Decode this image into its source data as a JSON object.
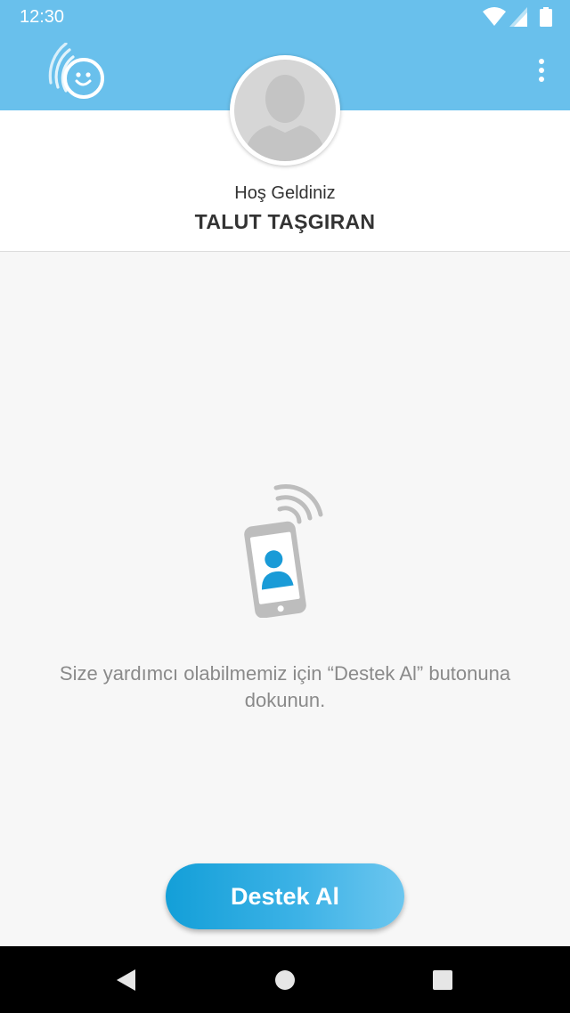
{
  "status_bar": {
    "time": "12:30",
    "icons": [
      "wifi-icon",
      "signal-icon",
      "battery-icon"
    ]
  },
  "header": {
    "logo_icon": "smile-signal-logo",
    "menu_icon": "more-vert-icon"
  },
  "profile": {
    "avatar_icon": "default-user-avatar",
    "welcome": "Hoş Geldiniz",
    "name": "TALUT TAŞGIRAN"
  },
  "main": {
    "illustration_icon": "phone-user-signal-icon",
    "instruction": "Size yardımcı olabilmemiz için “Destek Al” butonuna dokunun."
  },
  "actions": {
    "support_button": "Destek Al"
  },
  "nav": {
    "back_icon": "back-triangle-icon",
    "home_icon": "home-circle-icon",
    "recents_icon": "recents-square-icon"
  },
  "colors": {
    "header": "#69c0ec",
    "accent": "#139fd8",
    "background": "#f7f7f7",
    "text_muted": "#8a8a8a"
  }
}
